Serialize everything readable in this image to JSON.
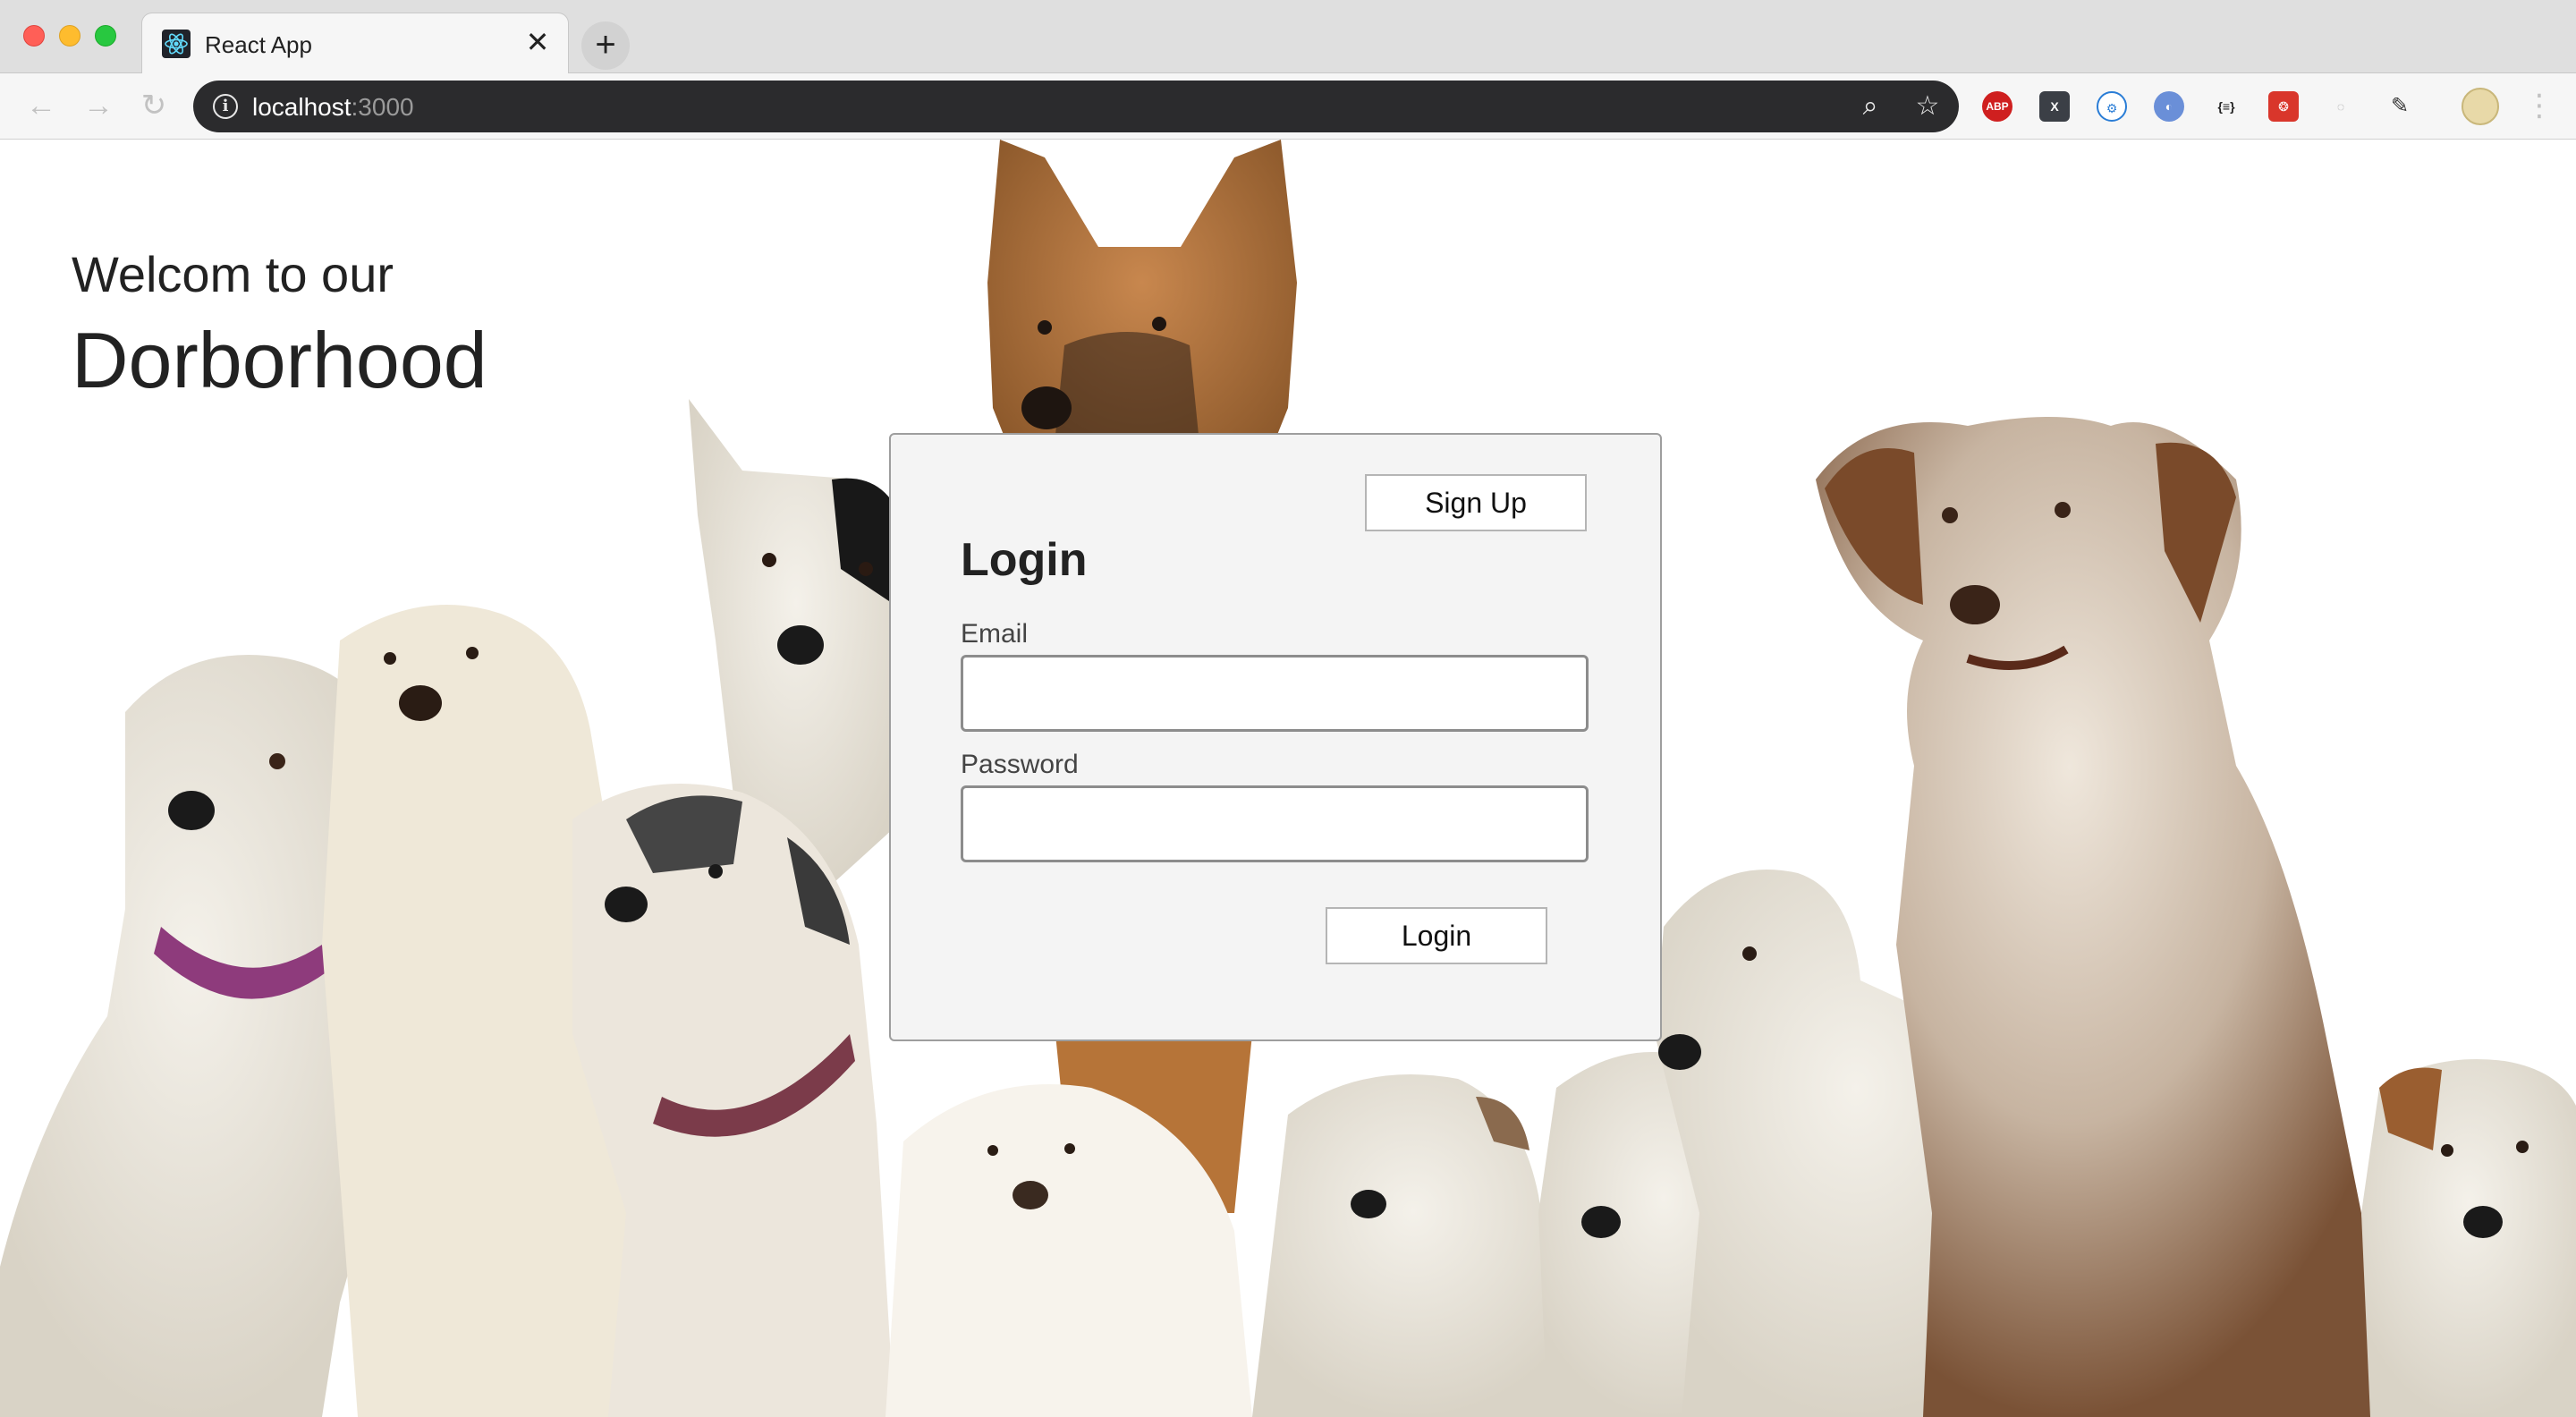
{
  "browser": {
    "tab_title": "React App",
    "tab_close": "✕",
    "new_tab": "+",
    "url_host": "localhost",
    "url_port": ":3000",
    "extensions": [
      "ABP",
      "X",
      "⚙",
      "◐",
      "{≡}",
      "❂",
      "◌",
      "✎"
    ]
  },
  "hero": {
    "welcome": "Welcom to our",
    "brand": "Dorborhood"
  },
  "login_form": {
    "signup_label": "Sign Up",
    "title": "Login",
    "email_label": "Email",
    "email_value": "",
    "password_label": "Password",
    "password_value": "",
    "submit_label": "Login"
  },
  "colors": {
    "accent_red": "#ff5f57",
    "card_bg": "#f4f4f4",
    "omnibox_bg": "#2b2b2d"
  },
  "icons": {
    "back": "arrow-left-icon",
    "forward": "arrow-right-icon",
    "reload": "reload-icon",
    "info": "info-icon",
    "zoom": "zoom-icon",
    "bookmark": "star-icon"
  }
}
